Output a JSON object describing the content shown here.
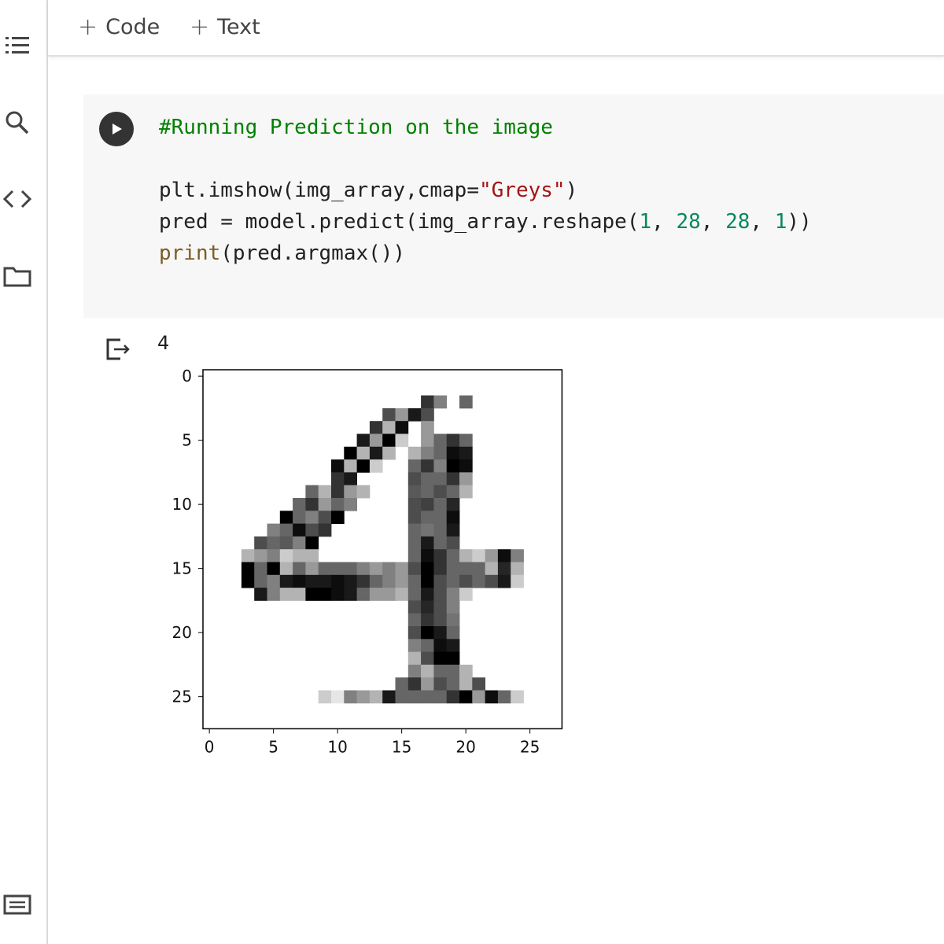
{
  "toolbar": {
    "code_label": "Code",
    "text_label": "Text",
    "plus": "+"
  },
  "rail": {
    "icons": [
      "table-of-contents-icon",
      "search-icon",
      "code-snippets-icon",
      "files-icon",
      "terminal-icon"
    ]
  },
  "cell": {
    "lines": [
      {
        "parts": [
          {
            "t": "#Running Prediction on the image",
            "c": "comment"
          }
        ]
      },
      {
        "parts": []
      },
      {
        "parts": [
          {
            "t": "plt.imshow(img_array,cmap=",
            "c": ""
          },
          {
            "t": "\"Greys\"",
            "c": "str"
          },
          {
            "t": ")",
            "c": ""
          }
        ]
      },
      {
        "parts": [
          {
            "t": "pred = model.predict(img_array.reshape(",
            "c": ""
          },
          {
            "t": "1",
            "c": "num"
          },
          {
            "t": ", ",
            "c": ""
          },
          {
            "t": "28",
            "c": "num"
          },
          {
            "t": ", ",
            "c": ""
          },
          {
            "t": "28",
            "c": "num"
          },
          {
            "t": ", ",
            "c": ""
          },
          {
            "t": "1",
            "c": "num"
          },
          {
            "t": "))",
            "c": ""
          }
        ]
      },
      {
        "parts": [
          {
            "t": "print",
            "c": "fn"
          },
          {
            "t": "(pred.argmax())",
            "c": ""
          }
        ]
      }
    ]
  },
  "output": {
    "text": "4"
  },
  "colors": {
    "comment": "#008000",
    "string": "#a31515",
    "number": "#09885a",
    "function": "#795e26"
  },
  "chart_data": {
    "type": "heatmap",
    "cmap": "Greys",
    "shape": [
      28,
      28
    ],
    "x_ticks": [
      "0",
      "5",
      "10",
      "15",
      "20",
      "25"
    ],
    "y_ticks": [
      "0",
      "5",
      "10",
      "15",
      "20",
      "25"
    ],
    "nonzero_pixels": [
      [
        2,
        17,
        0.8
      ],
      [
        2,
        18,
        0.5
      ],
      [
        2,
        20,
        0.6
      ],
      [
        3,
        14,
        0.7
      ],
      [
        3,
        15,
        0.4
      ],
      [
        3,
        16,
        0.9
      ],
      [
        3,
        17,
        0.7
      ],
      [
        4,
        13,
        0.8
      ],
      [
        4,
        14,
        0.3
      ],
      [
        4,
        15,
        0.95
      ],
      [
        4,
        17,
        0.4
      ],
      [
        5,
        12,
        0.9
      ],
      [
        5,
        13,
        0.4
      ],
      [
        5,
        14,
        1.0
      ],
      [
        5,
        15,
        0.2
      ],
      [
        5,
        17,
        0.4
      ],
      [
        5,
        18,
        0.6
      ],
      [
        5,
        19,
        0.8
      ],
      [
        5,
        20,
        0.6
      ],
      [
        6,
        11,
        1.0
      ],
      [
        6,
        12,
        0.3
      ],
      [
        6,
        13,
        0.9
      ],
      [
        6,
        14,
        0.3
      ],
      [
        6,
        16,
        0.3
      ],
      [
        6,
        17,
        0.5
      ],
      [
        6,
        18,
        0.6
      ],
      [
        6,
        19,
        0.95
      ],
      [
        6,
        20,
        0.9
      ],
      [
        7,
        10,
        0.95
      ],
      [
        7,
        11,
        0.3
      ],
      [
        7,
        12,
        1.0
      ],
      [
        7,
        13,
        0.2
      ],
      [
        7,
        16,
        0.6
      ],
      [
        7,
        17,
        0.8
      ],
      [
        7,
        18,
        0.5
      ],
      [
        7,
        19,
        1.0
      ],
      [
        7,
        20,
        0.95
      ],
      [
        8,
        10,
        0.8
      ],
      [
        8,
        11,
        0.9
      ],
      [
        8,
        16,
        0.7
      ],
      [
        8,
        17,
        0.6
      ],
      [
        8,
        18,
        0.6
      ],
      [
        8,
        19,
        0.8
      ],
      [
        8,
        20,
        0.4
      ],
      [
        9,
        8,
        0.6
      ],
      [
        9,
        9,
        0.3
      ],
      [
        9,
        10,
        0.8
      ],
      [
        9,
        11,
        0.4
      ],
      [
        9,
        12,
        0.3
      ],
      [
        9,
        16,
        0.65
      ],
      [
        9,
        17,
        0.6
      ],
      [
        9,
        18,
        0.7
      ],
      [
        9,
        19,
        0.6
      ],
      [
        9,
        20,
        0.3
      ],
      [
        10,
        7,
        0.6
      ],
      [
        10,
        8,
        0.8
      ],
      [
        10,
        9,
        0.4
      ],
      [
        10,
        10,
        0.6
      ],
      [
        10,
        11,
        0.5
      ],
      [
        10,
        16,
        0.7
      ],
      [
        10,
        17,
        0.75
      ],
      [
        10,
        18,
        0.6
      ],
      [
        10,
        19,
        0.85
      ],
      [
        11,
        6,
        1.0
      ],
      [
        11,
        7,
        0.6
      ],
      [
        11,
        8,
        0.5
      ],
      [
        11,
        9,
        0.7
      ],
      [
        11,
        10,
        1.0
      ],
      [
        11,
        16,
        0.7
      ],
      [
        11,
        17,
        0.6
      ],
      [
        11,
        18,
        0.6
      ],
      [
        11,
        19,
        0.95
      ],
      [
        12,
        5,
        0.5
      ],
      [
        12,
        6,
        0.6
      ],
      [
        12,
        7,
        0.95
      ],
      [
        12,
        8,
        0.7
      ],
      [
        12,
        9,
        0.8
      ],
      [
        12,
        16,
        0.6
      ],
      [
        12,
        17,
        0.55
      ],
      [
        12,
        18,
        0.6
      ],
      [
        12,
        19,
        0.9
      ],
      [
        13,
        4,
        0.7
      ],
      [
        13,
        5,
        0.6
      ],
      [
        13,
        6,
        0.65
      ],
      [
        13,
        7,
        0.5
      ],
      [
        13,
        8,
        1.0
      ],
      [
        13,
        16,
        0.6
      ],
      [
        13,
        17,
        0.9
      ],
      [
        13,
        18,
        0.6
      ],
      [
        13,
        19,
        0.7
      ],
      [
        14,
        3,
        0.3
      ],
      [
        14,
        4,
        0.4
      ],
      [
        14,
        5,
        0.5
      ],
      [
        14,
        6,
        0.2
      ],
      [
        14,
        7,
        0.3
      ],
      [
        14,
        8,
        0.3
      ],
      [
        14,
        16,
        0.6
      ],
      [
        14,
        17,
        0.95
      ],
      [
        14,
        18,
        0.8
      ],
      [
        14,
        19,
        0.6
      ],
      [
        14,
        20,
        0.3
      ],
      [
        14,
        21,
        0.2
      ],
      [
        14,
        22,
        0.4
      ],
      [
        14,
        23,
        0.95
      ],
      [
        14,
        24,
        0.5
      ],
      [
        15,
        3,
        1.0
      ],
      [
        15,
        4,
        0.6
      ],
      [
        15,
        5,
        1.0
      ],
      [
        15,
        6,
        0.3
      ],
      [
        15,
        7,
        0.6
      ],
      [
        15,
        8,
        0.4
      ],
      [
        15,
        9,
        0.6
      ],
      [
        15,
        10,
        0.6
      ],
      [
        15,
        11,
        0.6
      ],
      [
        15,
        12,
        0.5
      ],
      [
        15,
        13,
        0.4
      ],
      [
        15,
        14,
        0.5
      ],
      [
        15,
        15,
        0.4
      ],
      [
        15,
        16,
        0.7
      ],
      [
        15,
        17,
        1.0
      ],
      [
        15,
        18,
        0.8
      ],
      [
        15,
        19,
        0.6
      ],
      [
        15,
        20,
        0.6
      ],
      [
        15,
        21,
        0.6
      ],
      [
        15,
        22,
        0.3
      ],
      [
        15,
        23,
        0.85
      ],
      [
        15,
        24,
        0.3
      ],
      [
        16,
        3,
        1.0
      ],
      [
        16,
        4,
        0.6
      ],
      [
        16,
        5,
        0.5
      ],
      [
        16,
        6,
        0.9
      ],
      [
        16,
        7,
        0.95
      ],
      [
        16,
        8,
        0.9
      ],
      [
        16,
        9,
        0.9
      ],
      [
        16,
        10,
        0.95
      ],
      [
        16,
        11,
        0.9
      ],
      [
        16,
        12,
        0.8
      ],
      [
        16,
        13,
        0.6
      ],
      [
        16,
        14,
        0.5
      ],
      [
        16,
        15,
        0.4
      ],
      [
        16,
        16,
        0.6
      ],
      [
        16,
        17,
        1.0
      ],
      [
        16,
        18,
        0.7
      ],
      [
        16,
        19,
        0.6
      ],
      [
        16,
        20,
        0.7
      ],
      [
        16,
        21,
        0.6
      ],
      [
        16,
        22,
        0.7
      ],
      [
        16,
        23,
        0.9
      ],
      [
        16,
        24,
        0.2
      ],
      [
        17,
        4,
        0.9
      ],
      [
        17,
        5,
        0.5
      ],
      [
        17,
        6,
        0.3
      ],
      [
        17,
        7,
        0.3
      ],
      [
        17,
        8,
        1.0
      ],
      [
        17,
        9,
        1.0
      ],
      [
        17,
        10,
        0.95
      ],
      [
        17,
        11,
        0.9
      ],
      [
        17,
        12,
        0.6
      ],
      [
        17,
        13,
        0.4
      ],
      [
        17,
        14,
        0.4
      ],
      [
        17,
        15,
        0.3
      ],
      [
        17,
        16,
        0.6
      ],
      [
        17,
        17,
        0.9
      ],
      [
        17,
        18,
        0.7
      ],
      [
        17,
        19,
        0.5
      ],
      [
        17,
        20,
        0.2
      ],
      [
        18,
        16,
        0.7
      ],
      [
        18,
        17,
        0.85
      ],
      [
        18,
        18,
        0.7
      ],
      [
        18,
        19,
        0.5
      ],
      [
        19,
        16,
        0.6
      ],
      [
        19,
        17,
        0.8
      ],
      [
        19,
        18,
        0.7
      ],
      [
        19,
        19,
        0.55
      ],
      [
        20,
        16,
        0.7
      ],
      [
        20,
        17,
        1.0
      ],
      [
        20,
        18,
        0.9
      ],
      [
        20,
        19,
        0.6
      ],
      [
        21,
        16,
        0.5
      ],
      [
        21,
        17,
        0.6
      ],
      [
        21,
        18,
        0.95
      ],
      [
        21,
        19,
        0.9
      ],
      [
        22,
        16,
        0.3
      ],
      [
        22,
        17,
        0.7
      ],
      [
        22,
        18,
        1.0
      ],
      [
        22,
        19,
        1.0
      ],
      [
        23,
        16,
        0.5
      ],
      [
        23,
        17,
        0.3
      ],
      [
        23,
        18,
        0.6
      ],
      [
        23,
        19,
        0.6
      ],
      [
        23,
        20,
        0.3
      ],
      [
        24,
        15,
        0.6
      ],
      [
        24,
        16,
        0.8
      ],
      [
        24,
        17,
        0.4
      ],
      [
        24,
        18,
        0.7
      ],
      [
        24,
        19,
        0.6
      ],
      [
        24,
        20,
        0.3
      ],
      [
        24,
        21,
        0.7
      ],
      [
        25,
        9,
        0.2
      ],
      [
        25,
        10,
        0.1
      ],
      [
        25,
        11,
        0.5
      ],
      [
        25,
        12,
        0.4
      ],
      [
        25,
        13,
        0.3
      ],
      [
        25,
        14,
        0.9
      ],
      [
        25,
        15,
        0.6
      ],
      [
        25,
        16,
        0.6
      ],
      [
        25,
        17,
        0.6
      ],
      [
        25,
        18,
        0.6
      ],
      [
        25,
        19,
        0.8
      ],
      [
        25,
        20,
        1.0
      ],
      [
        25,
        21,
        0.4
      ],
      [
        25,
        22,
        0.95
      ],
      [
        25,
        23,
        0.6
      ],
      [
        25,
        24,
        0.2
      ]
    ]
  }
}
